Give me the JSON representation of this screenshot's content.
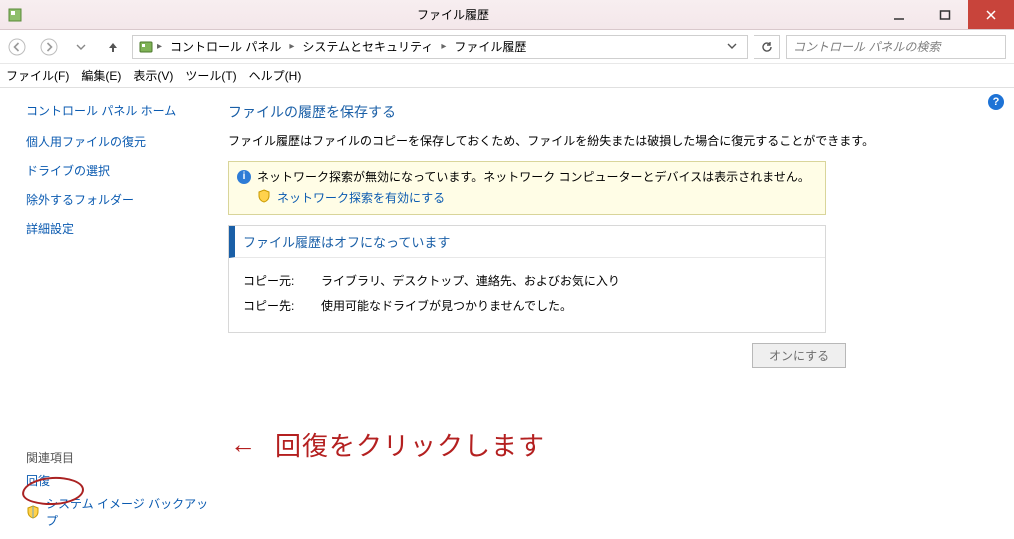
{
  "titlebar": {
    "title": "ファイル履歴"
  },
  "breadcrumb": {
    "items": [
      "コントロール パネル",
      "システムとセキュリティ",
      "ファイル履歴"
    ]
  },
  "search": {
    "placeholder": "コントロール パネルの検索"
  },
  "menubar": {
    "file": "ファイル(F)",
    "edit": "編集(E)",
    "view": "表示(V)",
    "tools": "ツール(T)",
    "help": "ヘルプ(H)"
  },
  "sidebar": {
    "home": "コントロール パネル ホーム",
    "links": [
      "個人用ファイルの復元",
      "ドライブの選択",
      "除外するフォルダー",
      "詳細設定"
    ],
    "related_label": "関連項目",
    "recovery": "回復",
    "image_backup": "システム イメージ バックアップ"
  },
  "main": {
    "heading": "ファイルの履歴を保存する",
    "description": "ファイル履歴はファイルのコピーを保存しておくため、ファイルを紛失または破損した場合に復元することができます。",
    "notice_text": "ネットワーク探索が無効になっています。ネットワーク コンピューターとデバイスは表示されません。",
    "notice_link": "ネットワーク探索を有効にする",
    "status_header": "ファイル履歴はオフになっています",
    "copy_from_label": "コピー元:",
    "copy_from_value": "ライブラリ、デスクトップ、連絡先、およびお気に入り",
    "copy_to_label": "コピー先:",
    "copy_to_value": "使用可能なドライブが見つかりませんでした。",
    "on_button": "オンにする"
  },
  "annotation": {
    "arrow": "←",
    "text": "回復をクリックします"
  }
}
